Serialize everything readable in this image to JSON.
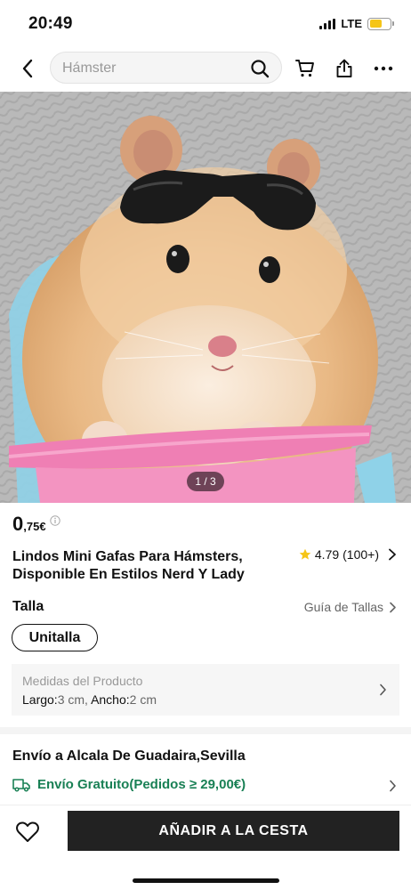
{
  "status_bar": {
    "time": "20:49",
    "network": "LTE",
    "battery_level": 0.6,
    "battery_color": "#f5c518"
  },
  "nav": {
    "search_placeholder": "Hámster",
    "icons": [
      "back-icon",
      "search-icon",
      "cart-icon",
      "share-icon",
      "more-icon"
    ]
  },
  "gallery": {
    "page_indicator": "1 / 3",
    "image_description_icon": "product-photo"
  },
  "product": {
    "price_int": "0",
    "price_dec": ",75€",
    "title": "Lindos Mini Gafas Para Hámsters, Disponible En Estilos Nerd Y Lady",
    "rating": "4.79",
    "rating_count": "(100+)",
    "star_color": "#f5c518"
  },
  "size": {
    "label": "Talla",
    "guide_label": "Guía de Tallas",
    "selected_option": "Unitalla"
  },
  "measures": {
    "title": "Medidas del Producto",
    "length_label": "Largo:",
    "length_value": "3 cm,",
    "width_label": "Ancho:",
    "width_value": "2 cm"
  },
  "shipping": {
    "title": "Envío a Alcala De Guadaira,Sevilla",
    "free_label": "Envío Gratuito(Pedidos ≥ 29,00€)",
    "accent_color": "#198055"
  },
  "bottom_bar": {
    "add_to_cart": "AÑADIR A LA CESTA"
  }
}
